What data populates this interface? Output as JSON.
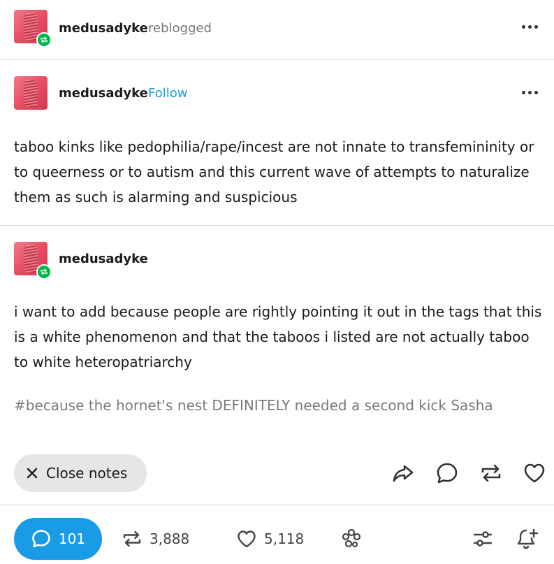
{
  "post": {
    "reblogger": {
      "username": "medusadyke",
      "action": "reblogged"
    },
    "original": {
      "username": "medusadyke",
      "follow_label": "Follow",
      "text": "taboo kinks like pedophilia/rape/incest are not innate to transfemininity or to queerness or to autism and this current wave of attempts to naturalize them as such is alarming and suspicious"
    },
    "addition": {
      "username": "medusadyke",
      "text": "i want to add because people are rightly pointing it out in the tags that this is a white phenomenon and that the taboos i listed are not actually taboo to white heteropatriarchy",
      "tags": "#because the hornet's nest DEFINITELY needed a second kick Sasha"
    }
  },
  "footer": {
    "close_notes_label": "Close notes",
    "replies_count": "101",
    "reblogs_count": "3,888",
    "likes_count": "5,118"
  },
  "colors": {
    "accent": "#1a9be6",
    "reblog_badge": "#00b84a"
  },
  "icons": [
    "more-icon",
    "reblog-badge-icon",
    "close-icon",
    "share-icon",
    "reply-icon",
    "reblog-icon",
    "like-icon",
    "comment-bubble-icon",
    "community-icon",
    "filter-icon",
    "bell-plus-icon"
  ]
}
